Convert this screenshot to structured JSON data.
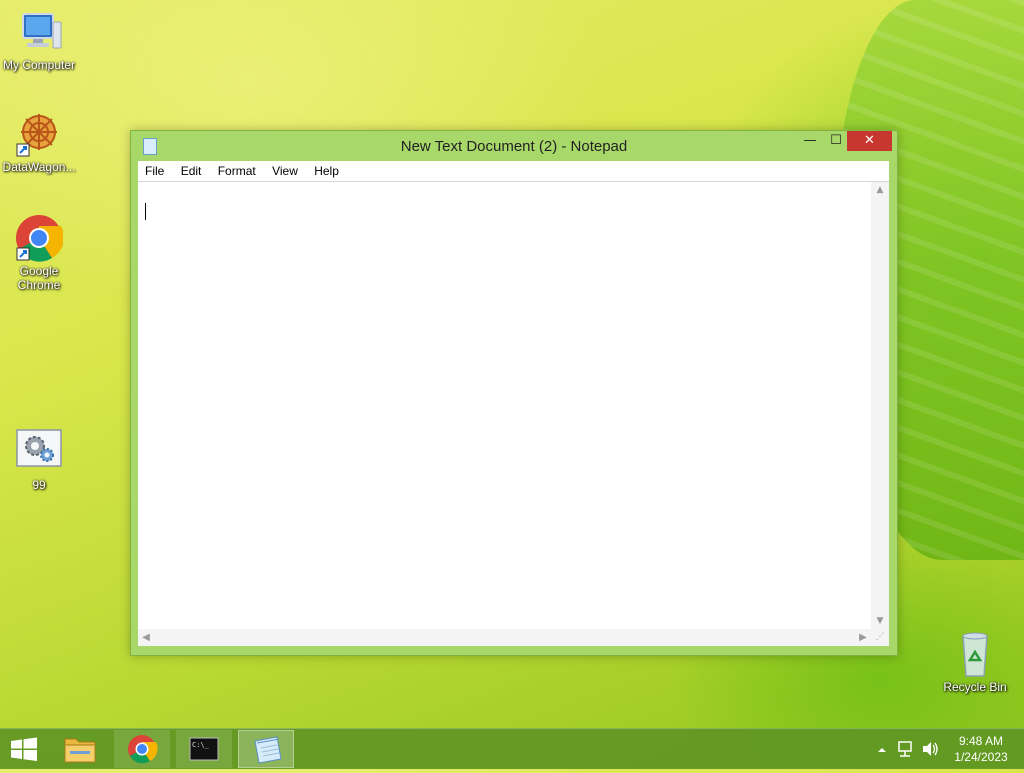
{
  "desktop": {
    "icons": [
      {
        "label": "My Computer",
        "icon": "computer-icon"
      },
      {
        "label": "DataWagon...",
        "icon": "datawagon-icon"
      },
      {
        "label": "Google Chrome",
        "icon": "chrome-icon"
      },
      {
        "label": "99",
        "icon": "settings-file-icon"
      },
      {
        "label": "Recycle Bin",
        "icon": "recycle-bin-icon"
      }
    ]
  },
  "window": {
    "title": "New Text Document (2) - Notepad",
    "controls": {
      "minimize": "—",
      "maximize": "☐",
      "close": "✕"
    },
    "menu": [
      "File",
      "Edit",
      "Format",
      "View",
      "Help"
    ],
    "content": ""
  },
  "taskbar": {
    "buttons": [
      {
        "name": "file-explorer",
        "icon": "folder-icon"
      },
      {
        "name": "google-chrome",
        "icon": "chrome-icon"
      },
      {
        "name": "command-prompt",
        "icon": "cmd-icon"
      },
      {
        "name": "notepad",
        "icon": "notepad-icon",
        "active": true
      }
    ],
    "clock": {
      "time": "9:48 AM",
      "date": "1/24/2023"
    }
  },
  "colors": {
    "titlebar": "#a9d86a",
    "close": "#c7372f",
    "taskbar": "#5f9623"
  }
}
